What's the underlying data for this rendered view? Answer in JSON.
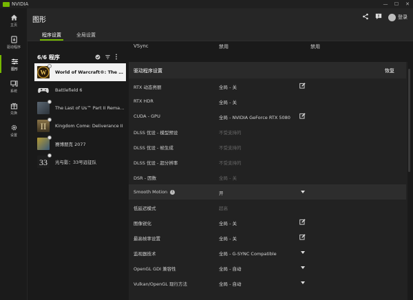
{
  "app": {
    "title": "NVIDIA",
    "accent": "#76b900"
  },
  "window_controls": [
    "minimize-icon",
    "maximize-icon",
    "close-icon"
  ],
  "nav": [
    {
      "id": "home",
      "label": "主页",
      "icon": "home-icon"
    },
    {
      "id": "drivers",
      "label": "驱动程序",
      "icon": "driver-icon"
    },
    {
      "id": "graphics",
      "label": "图形",
      "icon": "sliders-icon",
      "active": true
    },
    {
      "id": "system",
      "label": "系统",
      "icon": "monitor-icon"
    },
    {
      "id": "redeem",
      "label": "兑换",
      "icon": "gift-icon"
    },
    {
      "id": "settings",
      "label": "设置",
      "icon": "gear-icon"
    }
  ],
  "header": {
    "title": "图形",
    "login": "登录",
    "icons": [
      "share-icon",
      "feedback-icon",
      "user-avatar-icon"
    ]
  },
  "tabs": [
    {
      "label": "程序设置",
      "active": true
    },
    {
      "label": "全局设置",
      "active": false
    }
  ],
  "programs": {
    "count_label": "6/6 程序",
    "tools": [
      "check-circle-icon",
      "filter-icon",
      "more-vertical-icon"
    ],
    "items": [
      {
        "name": "World of Warcraft®: The War Within",
        "selected": true,
        "thumb_color": "#3a2a10",
        "icon": "wow-game-icon"
      },
      {
        "name": "Battlefield 6",
        "selected": false,
        "thumb_color": "#1a1a1a",
        "icon": "gamepad-icon"
      },
      {
        "name": "The Last of Us™ Part II Remastered",
        "selected": false,
        "thumb_color": "#4a5560",
        "icon": "tlou-game-icon"
      },
      {
        "name": "Kingdom Come: Deliverance II",
        "selected": false,
        "thumb_color": "#6a5a3a",
        "icon": "kcd-game-icon"
      },
      {
        "name": "赛博朋克 2077",
        "selected": false,
        "thumb_color": "#7a6a2a",
        "icon": "cyberpunk-game-icon"
      },
      {
        "name": "光与影：33号远征队",
        "selected": false,
        "thumb_color": "#2a2a2a",
        "icon": "expedition-game-icon"
      }
    ]
  },
  "vsync_row": {
    "label": "VSync",
    "value": "禁用",
    "value2": "禁用"
  },
  "driver_section": {
    "title": "驱动程序设置",
    "restore": "恢复",
    "rows": [
      {
        "label": "RTX 动态亮丽",
        "value": "全局 - 关",
        "action": "edit"
      },
      {
        "label": "RTX HDR",
        "value": "全局 - 关",
        "action": ""
      },
      {
        "label": "CUDA - GPU",
        "value": "全局 - NVIDIA GeForce RTX 5080",
        "action": "edit"
      },
      {
        "label": "DLSS 优设 - 模型预设",
        "value": "不受支持的",
        "dim": true,
        "action": ""
      },
      {
        "label": "DLSS 优设 - 帧生成",
        "value": "不受支持的",
        "dim": true,
        "action": ""
      },
      {
        "label": "DLSS 优设 - 超分辨率",
        "value": "不受支持的",
        "dim": true,
        "action": ""
      },
      {
        "label": "DSR - 因数",
        "value": "全局 - 关",
        "dim": true,
        "action": ""
      },
      {
        "label": "Smooth Motion",
        "value": "开",
        "action": "dropdown",
        "info": true,
        "highlight": true
      },
      {
        "label": "低延迟模式",
        "value": "超高",
        "dim": true,
        "action": ""
      },
      {
        "label": "图像锐化",
        "value": "全局 - 关",
        "action": "edit"
      },
      {
        "label": "最高帧率设置",
        "value": "全局 - 关",
        "action": "edit"
      },
      {
        "label": "监视器技术",
        "value": "全局 - G-SYNC Compatible",
        "action": "dropdown"
      },
      {
        "label": "OpenGL GDI 兼容性",
        "value": "全局 - 自动",
        "action": "dropdown"
      },
      {
        "label": "Vulkan/OpenGL 现行方法",
        "value": "全局 - 自动",
        "action": "dropdown"
      }
    ]
  }
}
